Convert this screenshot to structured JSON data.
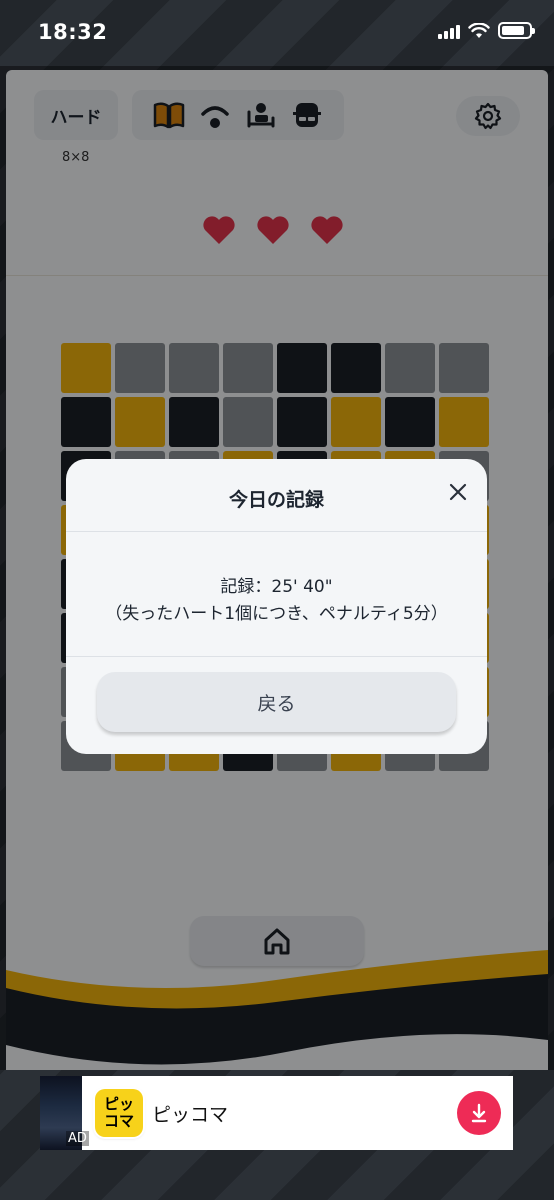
{
  "status_bar": {
    "time": "18:32"
  },
  "header": {
    "difficulty": "ハード",
    "grid_size": "8×8",
    "tools": [
      {
        "icon": "book-icon"
      },
      {
        "icon": "awake-icon"
      },
      {
        "icon": "sleep-icon"
      },
      {
        "icon": "spy-icon"
      }
    ],
    "settings_icon": "gear-icon"
  },
  "lives": {
    "count": 3,
    "icon": "heart-icon",
    "color": "#e0334a"
  },
  "board": {
    "size": 8,
    "colors": {
      "Y": "#f0b20d",
      "G": "#8b8f94",
      "D": "#1a1f27"
    },
    "rows": [
      [
        "Y",
        "G",
        "G",
        "G",
        "D",
        "D",
        "G",
        "G"
      ],
      [
        "D",
        "Y",
        "D",
        "G",
        "D",
        "Y",
        "D",
        "Y"
      ],
      [
        "D",
        "G",
        "G",
        "Y",
        "D",
        "Y",
        "Y",
        "G"
      ],
      [
        "Y",
        "D",
        "G",
        "D",
        "G",
        "G",
        "G",
        "Y"
      ],
      [
        "D",
        "G",
        "Y",
        "G",
        "D",
        "G",
        "G",
        "Y"
      ],
      [
        "D",
        "D",
        "G",
        "G",
        "Y",
        "D",
        "G",
        "Y"
      ],
      [
        "G",
        "D",
        "Y",
        "D",
        "G",
        "G",
        "D",
        "Y"
      ],
      [
        "G",
        "Y",
        "Y",
        "D",
        "G",
        "Y",
        "G",
        "G"
      ]
    ]
  },
  "footer": {
    "home_icon": "home-icon"
  },
  "modal": {
    "title": "今日の記録",
    "record": "記録：25' 40\"",
    "note": "（失ったハート1個につき、ペナルティ5分）",
    "back_button": "戻る"
  },
  "ad": {
    "tag": "AD",
    "logo_line1": "ピッ",
    "logo_line2": "コマ",
    "app_name": "ピッコマ",
    "accent": "#ee2b56"
  }
}
